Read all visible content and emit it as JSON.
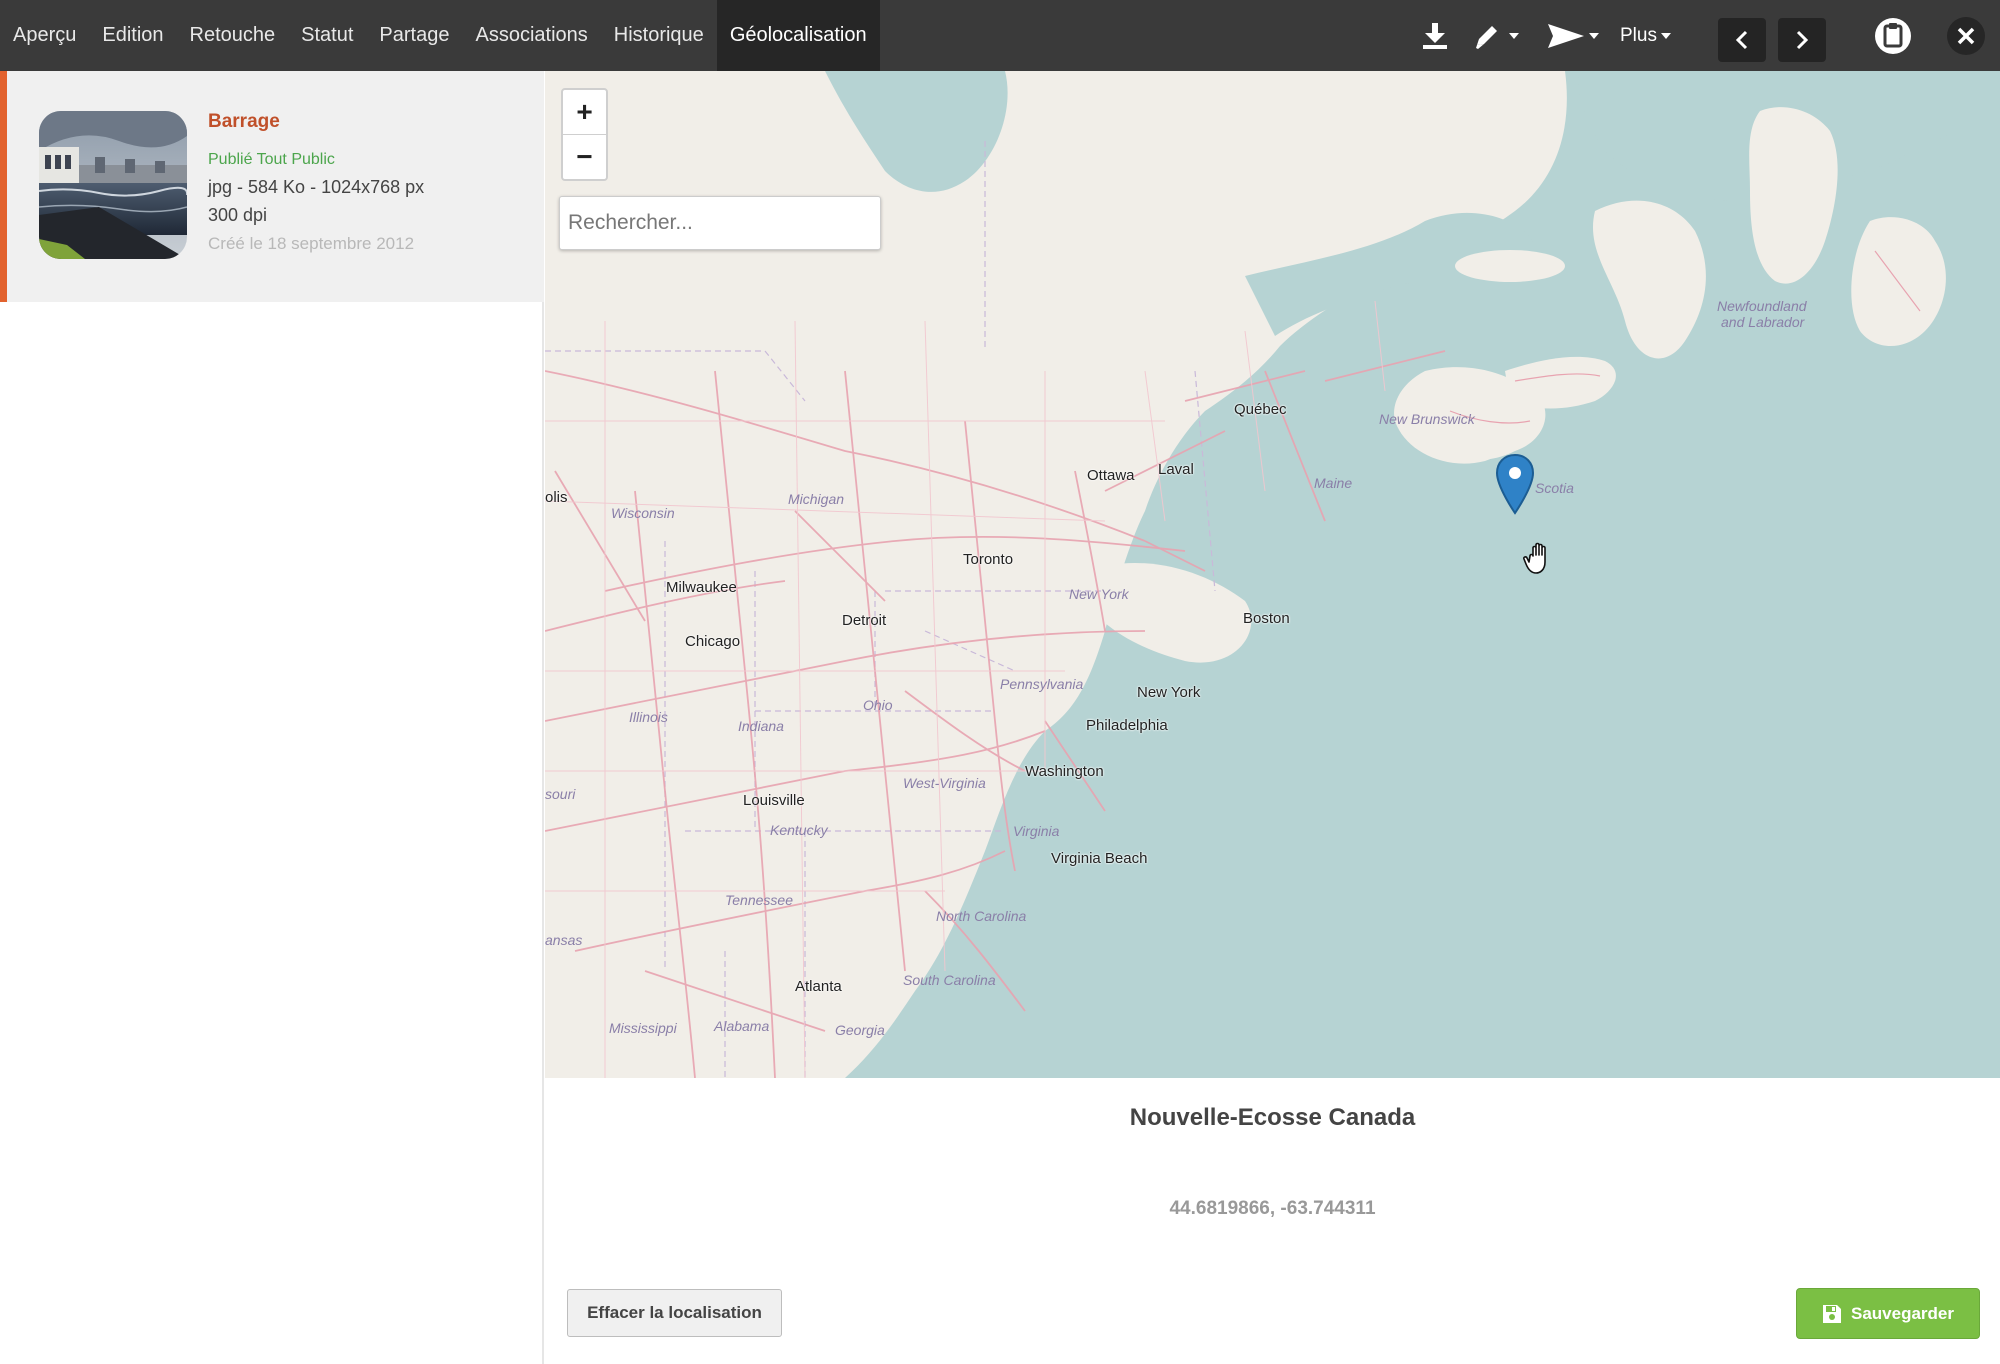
{
  "toolbar": {
    "tabs": [
      {
        "label": "Aperçu"
      },
      {
        "label": "Edition"
      },
      {
        "label": "Retouche"
      },
      {
        "label": "Statut"
      },
      {
        "label": "Partage"
      },
      {
        "label": "Associations"
      },
      {
        "label": "Historique"
      },
      {
        "label": "Géolocalisation",
        "active": true
      }
    ],
    "more_label": "Plus",
    "icons": [
      "download-icon",
      "pencil-icon",
      "send-icon",
      "chevron-left-icon",
      "chevron-right-icon",
      "clipboard-icon",
      "close-icon"
    ]
  },
  "media": {
    "title": "Barrage",
    "status": "Publié Tout Public",
    "info": "jpg - 584 Ko - 1024x768 px",
    "dpi": "300 dpi",
    "created": "Créé le 18 septembre 2012",
    "accent_color": "#e2622e"
  },
  "map": {
    "zoom_in_label": "+",
    "zoom_out_label": "−",
    "search_placeholder": "Rechercher...",
    "cities": [
      "Québec",
      "Ottawa",
      "Laval",
      "Toronto",
      "Milwaukee",
      "Chicago",
      "Detroit",
      "Boston",
      "New York",
      "Philadelphia",
      "Washington",
      "Louisville",
      "Virginia Beach",
      "Atlanta",
      "olis"
    ],
    "regions": [
      "New Brunswick",
      "Maine",
      "Wisconsin",
      "Michigan",
      "New York",
      "Pennsylvania",
      "Ohio",
      "Illinois",
      "Indiana",
      "West-Virginia",
      "Virginia",
      "Kentucky",
      "souri",
      "Tennessee",
      "North Carolina",
      "South Carolina",
      "ansas",
      "Mississippi",
      "Alabama",
      "Georgia",
      "Newfoundland",
      "and Labrador",
      "Scotia"
    ],
    "marker_color": "#2f82c7"
  },
  "location": {
    "name": "Nouvelle-Ecosse Canada",
    "coordinates": "44.6819866, -63.744311"
  },
  "actions": {
    "clear_label": "Effacer la localisation",
    "save_label": "Sauvegarder",
    "save_color": "#7bbf44"
  }
}
